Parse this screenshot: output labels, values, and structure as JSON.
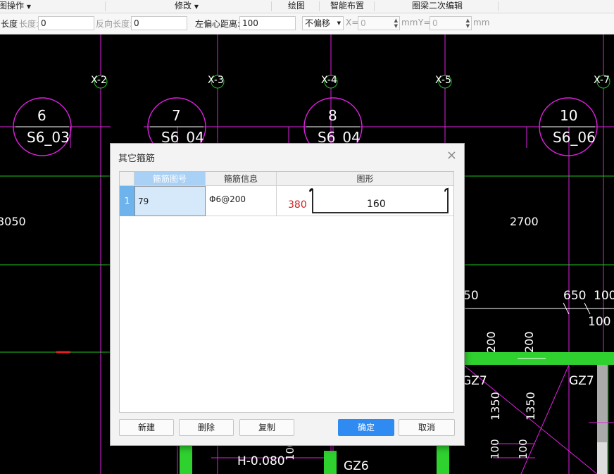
{
  "toolbar_groups": {
    "g1": "图操作",
    "g2": "修改",
    "g3": "绘图",
    "g4": "智能布置",
    "g5": "圈梁二次编辑"
  },
  "params": {
    "length_prefix": "长度",
    "length_label": "长度:",
    "length_value": "0",
    "reverse_length_label": "反向长度:",
    "reverse_length_value": "0",
    "offset_label": "左偏心距离:",
    "offset_value": "100",
    "offset_mode": "不偏移",
    "x_label": "X=",
    "x_value": "0",
    "x_unit": "mm",
    "y_label": "Y=",
    "y_value": "0",
    "y_unit": "mm"
  },
  "cad": {
    "axes": [
      "X-2",
      "X-3",
      "X-4",
      "X-5",
      "X-7"
    ],
    "bubbles": [
      {
        "num": "6",
        "sub": "S6_03"
      },
      {
        "num": "7",
        "sub": "S6_04"
      },
      {
        "num": "8",
        "sub": "S6_04"
      },
      {
        "num": "10",
        "sub": "S6_06"
      }
    ],
    "dim_left": "3050",
    "dim_right": "2700",
    "dim_50": "50",
    "dim_650": "650",
    "dim_100a": "100",
    "dim_100b": "100",
    "dim_200a": "200",
    "dim_200b": "200",
    "dim_1350a": "1350",
    "dim_1350b": "1350",
    "dim_100c": "100",
    "dim_100d": "100",
    "label_gz7a": "GZ7",
    "label_gz7b": "GZ7",
    "label_gz6": "GZ6",
    "label_h": "H-0.080",
    "label_100e": "100"
  },
  "dialog": {
    "title": "其它箍筋",
    "close": "×",
    "columns": [
      "箍筋图号",
      "箍筋信息",
      "图形"
    ],
    "rows": [
      {
        "num": "1",
        "shape_code": "79",
        "info": "Φ6@200",
        "dim_height": "380",
        "dim_width": "160"
      }
    ],
    "buttons": {
      "new": "新建",
      "delete": "删除",
      "copy": "复制",
      "ok": "确定",
      "cancel": "取消"
    }
  }
}
